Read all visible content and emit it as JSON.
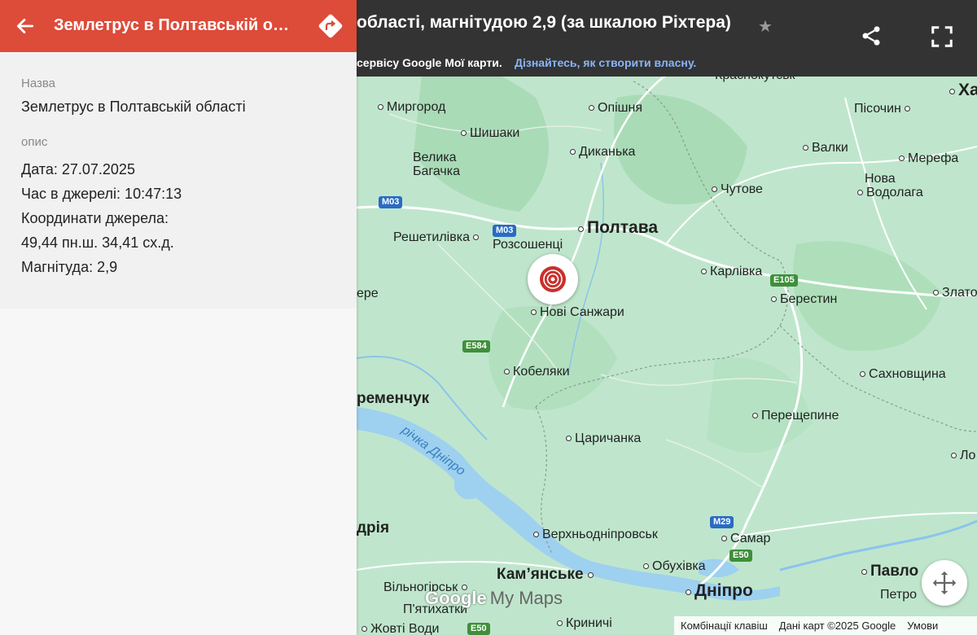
{
  "panel": {
    "title": "Землетрус в Полтавській обл...",
    "name_label": "Назва",
    "name_value": "Землетрус в Полтавській області",
    "desc_label": "опис",
    "desc_value": "Дата: 27.07.2025\nЧас в джерелі: 10:47:13\nКоординати джерела:\n49,44 пн.ш. 34,41 сх.д.\nМагнітуда: 2,9"
  },
  "map_header": {
    "title": "області, магнітудою 2,9 (за шкалою Ріхтера)",
    "subtitle_text": "сервісу Google Мої карти.",
    "subtitle_link": "Дізнайтесь, як створити власну."
  },
  "places": {
    "krasnokutsk": "Краснокутськ",
    "myrhorod": "Миргород",
    "opishnia": "Опішня",
    "shyshaky": "Шишаки",
    "dykanka": "Диканька",
    "velyka": "Велика",
    "bahachka": "Багачка",
    "kharkiv": "Ха",
    "pisochyn": "Пісочин",
    "valky": "Валки",
    "merefa": "Мерефа",
    "nova": "Нова",
    "vodolaha": "Водолага",
    "chutove": "Чутове",
    "poltava": "Полтава",
    "reshetylivka": "Решетилівка",
    "rozsoshentsi": "Розсошенці",
    "karlivka": "Карлівка",
    "berestyn": "Берестин",
    "zlato": "Злато",
    "nearedge": "ере",
    "novi_sanzhary": "Нові Санжари",
    "kobeliaky": "Кобеляки",
    "sakhnovshchyna": "Сахновщина",
    "kremenchuk": "ременчук",
    "pereshchepyne": "Перещепине",
    "tsarychanka": "Царичанка",
    "lo": "Ло",
    "river_dnipro": "річка Дніпро",
    "oleksandriia": "дрія",
    "verkhnodniprovsk": "Верхньодніпровськ",
    "samar": "Самар",
    "obukhivka": "Обухівка",
    "pavlohrad": "Павло",
    "kamianske": "Кам’янське",
    "dnipro": "Дніпро",
    "petropavlivka": "Петро",
    "vilnohirsk": "Вільногірськ",
    "piatykhatky": "П'ятихатки",
    "kryvychi": "Криничі",
    "zhovti_vody": "Жовті Води"
  },
  "roads": {
    "m03_a": "M03",
    "m03_b": "M03",
    "e105": "E105",
    "e584": "E584",
    "m29": "M29",
    "e50_a": "E50",
    "e50_b": "E50"
  },
  "branding": {
    "google": "Google",
    "mymaps": "My Maps"
  },
  "footer": {
    "shortcuts": "Комбінації клавіш",
    "map_data": "Дані карт ©2025 Google",
    "terms": "Умови"
  },
  "colors": {
    "header_red": "#dd4b39",
    "map_green": "#bfe6cc",
    "water": "#9ed0f0",
    "topbar": "#333333"
  },
  "icons": {
    "back": "arrow-left",
    "directions": "directions-diamond",
    "star": "star",
    "share": "share",
    "fullscreen": "fullscreen",
    "marker": "target-rings",
    "recenter": "recenter-cross"
  }
}
